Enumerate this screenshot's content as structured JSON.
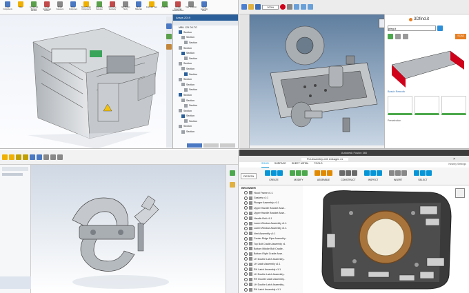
{
  "q1": {
    "app": "SolidWorks",
    "toolbar_labels": [
      "Insert Components",
      "Mate",
      "Component Preview Window",
      "Linear Component Pattern",
      "Smart Fasteners",
      "Move Component",
      "Show Hidden Components",
      "Assembly Features",
      "Reference Geometry",
      "New Motion Study",
      "Bill of Materials",
      "Exploded View",
      "Instant3D",
      "Update Speedpak Subassemblies",
      "Take Snapshot",
      "Large Assembly Mode"
    ],
    "panel_title": "Ansys 2019",
    "tree_root": "MBU 125 D5-TG",
    "tree_item": "Section"
  },
  "q2": {
    "app": "FreeCAD",
    "zoom": "100%",
    "brand": "3Dfind.it",
    "search_value": "pfeg.it",
    "result_label": "Bosch Rexroth",
    "status_text": "Preselection",
    "badge": "SCAD"
  },
  "q3": {
    "app": "SolidWorks"
  },
  "q4": {
    "title": "Autodesk Fusion 360",
    "doc_tab": "Pot Assembly with Linkages v1",
    "tabs": [
      "SOLID",
      "SURFACE",
      "SHEET METAL",
      "TOOLS"
    ],
    "design_label": "DESIGN",
    "groups": [
      "CREATE",
      "MODIFY",
      "ASSEMBLE",
      "CONSTRUCT",
      "INSPECT",
      "INSERT",
      "SELECT"
    ],
    "browser_header": "BROWSER",
    "tree_items": [
      "Hood Frame v1:1",
      "Gaskets v1:1",
      "Plunger Assembly v1:1",
      "Upper Handle Bracket Asse..",
      "Upper Handle Bracket Asse..",
      "Handle Bolt v1:1",
      "Lower Window Assembly v1:1",
      "Lower Window Assembly v1:1",
      "Vent Assembly v1:1",
      "Center Ridge Pipe Assembly..",
      "Top Bolt Cradle Assembly v1",
      "Bottom Middle Bolt Cradle..",
      "Bottom Right Cradle Asse..",
      "LH Double Latch Assembly..",
      "LH Latch Assembly v1:1",
      "RH Latch Assembly v1:1",
      "LH Double Latch Assembly..",
      "RH Double Latch Assembly..",
      "LH Double Latch Assembly..",
      "RH Latch Assembly v1:1"
    ],
    "right_label": "Nearby Settings"
  },
  "colors": {
    "sw_bg": "#eef1f6",
    "freecad_bg": "#3d5d80",
    "fusion_blue": "#0696d7",
    "accent_red": "#d0021b"
  }
}
